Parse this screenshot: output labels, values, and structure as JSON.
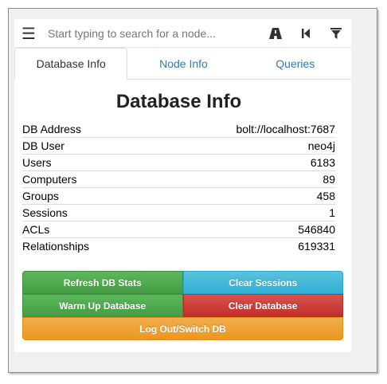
{
  "search": {
    "placeholder": "Start typing to search for a node..."
  },
  "icons": {
    "menu": "menu-icon",
    "path": "path-icon",
    "back": "back-icon",
    "filter": "filter-icon"
  },
  "tabs": [
    {
      "label": "Database Info",
      "active": true
    },
    {
      "label": "Node Info",
      "active": false
    },
    {
      "label": "Queries",
      "active": false
    }
  ],
  "database_info": {
    "title": "Database Info",
    "rows": [
      {
        "label": "DB Address",
        "value": "bolt://localhost:7687"
      },
      {
        "label": "DB User",
        "value": "neo4j"
      },
      {
        "label": "Users",
        "value": "6183"
      },
      {
        "label": "Computers",
        "value": "89"
      },
      {
        "label": "Groups",
        "value": "458"
      },
      {
        "label": "Sessions",
        "value": "1"
      },
      {
        "label": "ACLs",
        "value": "546840"
      },
      {
        "label": "Relationships",
        "value": "619331"
      }
    ]
  },
  "buttons": {
    "refresh": "Refresh DB Stats",
    "clear_sessions": "Clear Sessions",
    "warm_up": "Warm Up Database",
    "clear_database": "Clear Database",
    "logout": "Log Out/Switch DB"
  },
  "colors": {
    "green": "#5cb85c",
    "blue": "#5bc0de",
    "red": "#d9534f",
    "orange": "#f0ad4e",
    "link": "#337ab7"
  }
}
